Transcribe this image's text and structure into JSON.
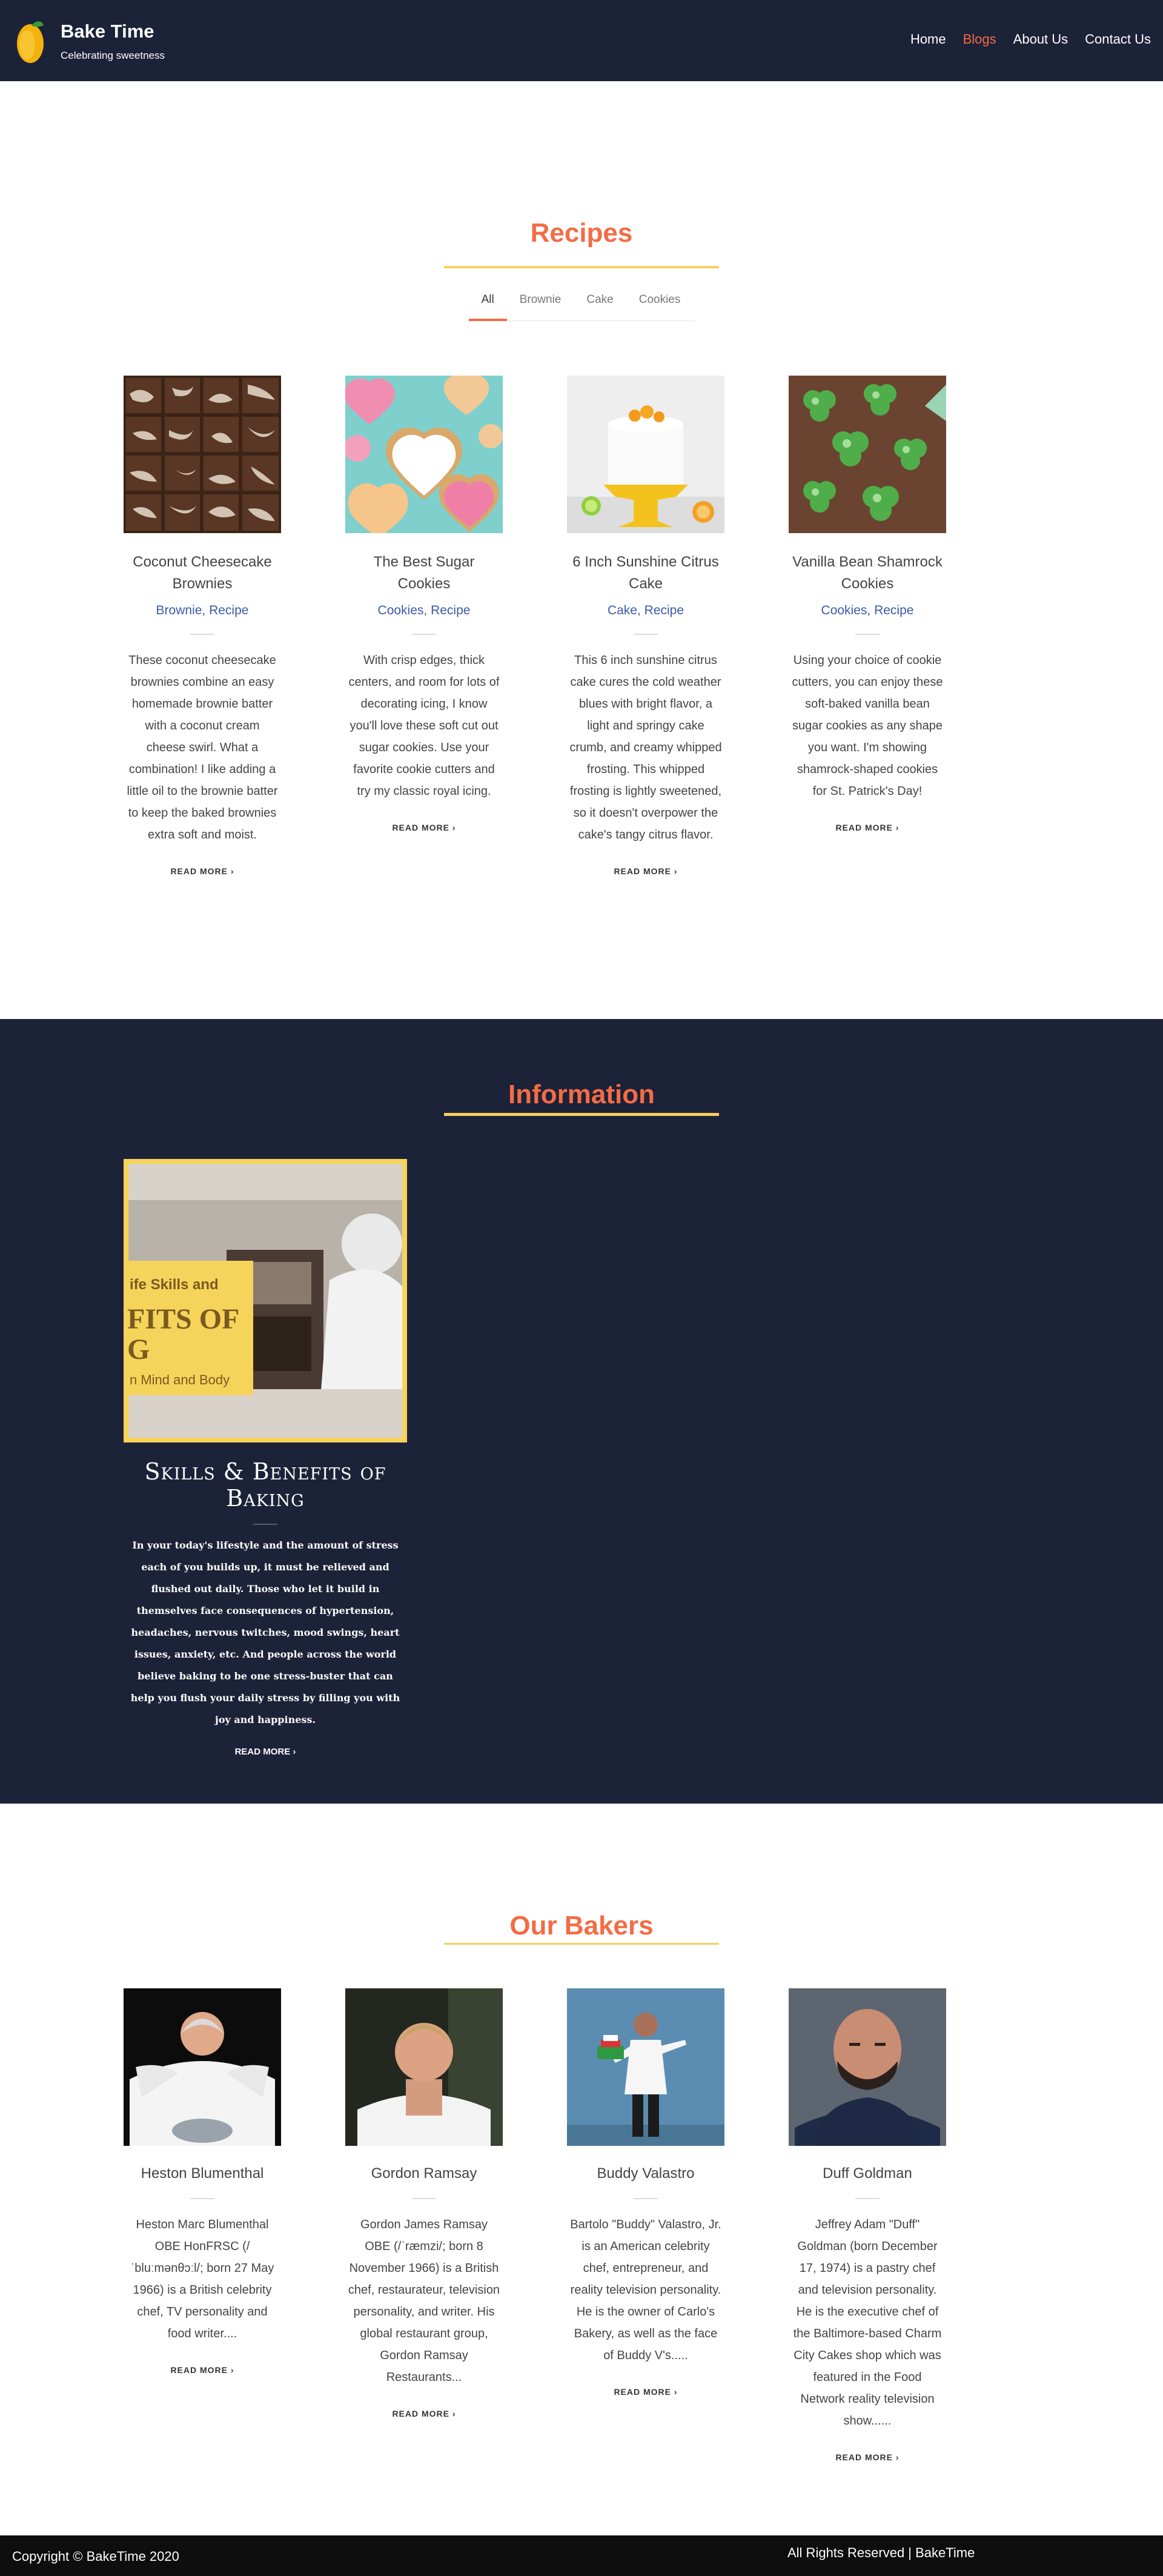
{
  "header": {
    "brand_name": "Bake Time",
    "tagline": "Celebrating sweetness",
    "nav": [
      "Home",
      "Blogs",
      "About Us",
      "Contact Us"
    ],
    "active_nav": "Blogs"
  },
  "recipes": {
    "title": "Recipes",
    "filters": [
      "All",
      "Brownie",
      "Cake",
      "Cookies"
    ],
    "active_filter": "All",
    "cards": [
      {
        "title": "Coconut Cheesecake Brownies",
        "cat1": "Brownie",
        "sep": ", ",
        "cat2": "Recipe",
        "desc": "These coconut cheesecake brownies combine an easy homemade brownie batter with a coconut cream cheese swirl. What a combination! I like adding a little oil to the brownie batter to keep the baked brownies extra soft and moist.",
        "read_more": "READ MORE  ›"
      },
      {
        "title": "The Best Sugar Cookies",
        "cat1": "Cookies",
        "sep": ", ",
        "cat2": "Recipe",
        "desc": "With crisp edges, thick centers, and room for lots of decorating icing, I know you'll love these soft cut out sugar cookies. Use your favorite cookie cutters and try my classic royal icing.",
        "read_more": "READ MORE  ›"
      },
      {
        "title": "6 Inch Sunshine Citrus Cake",
        "cat1": "Cake",
        "sep": ", ",
        "cat2": "Recipe",
        "desc": "This 6 inch sunshine citrus cake cures the cold weather blues with bright flavor, a light and springy cake crumb, and creamy whipped frosting. This whipped frosting is lightly sweetened, so it doesn't overpower the cake's tangy citrus flavor.",
        "read_more": "READ MORE  ›"
      },
      {
        "title": "Vanilla Bean Shamrock Cookies",
        "cat1": "Cookies",
        "sep": ", ",
        "cat2": "Recipe",
        "desc": "Using your choice of cookie cutters, you can enjoy these soft-baked vanilla bean sugar cookies as any shape you want. I'm showing shamrock-shaped cookies for St. Patrick's Day!",
        "read_more": "READ MORE  ›"
      }
    ]
  },
  "information": {
    "title": "Information",
    "image_text": [
      "ife Skills and",
      "FITS OF",
      "G",
      "n Mind and Body"
    ],
    "card_title": "Skills & Benefits of Baking",
    "desc": "In your today's lifestyle and the amount of stress each of you builds up, it must be relieved and flushed out daily. Those who let it build in themselves face consequences of hypertension, headaches, nervous twitches, mood swings, heart issues, anxiety, etc. And people across the world believe baking to be one stress-buster that can help you flush your daily stress by filling you with joy and happiness.",
    "read_more": "READ MORE  ›"
  },
  "bakers": {
    "title": "Our Bakers",
    "cards": [
      {
        "name": "Heston Blumenthal",
        "desc": "Heston Marc Blumenthal OBE HonFRSC (/ ˈbluːmənθɔːl/; born 27 May 1966) is a British celebrity chef, TV personality and food writer....",
        "read_more": "READ MORE  ›"
      },
      {
        "name": "Gordon Ramsay",
        "desc": "Gordon James Ramsay OBE (/ˈræmzi/; born 8 November 1966) is a British chef, restaurateur, television personality, and writer. His global restaurant group, Gordon Ramsay Restaurants...",
        "read_more": "READ MORE  ›"
      },
      {
        "name": "Buddy Valastro",
        "desc": "Bartolo \"Buddy\" Valastro, Jr. is an American celebrity chef, entrepreneur, and reality television personality. He is the owner of Carlo's Bakery, as well as the face of Buddy V's.....",
        "read_more": "READ MORE  ›"
      },
      {
        "name": "Duff Goldman",
        "desc": "Jeffrey Adam \"Duff\" Goldman (born December 17, 1974) is a pastry chef and television personality. He is the executive chef of the Baltimore-based Charm City Cakes shop which was featured in the Food Network reality television show......",
        "read_more": "READ MORE  ›"
      }
    ]
  },
  "footer": {
    "copyright": "Copyright © BakeTime 2020",
    "rights": "All Rights Reserved | BakeTime"
  },
  "colors": {
    "navy": "#1c2237",
    "accent": "#f36c45",
    "gold": "#f6cf5f",
    "link_blue": "#3b5ba8"
  }
}
